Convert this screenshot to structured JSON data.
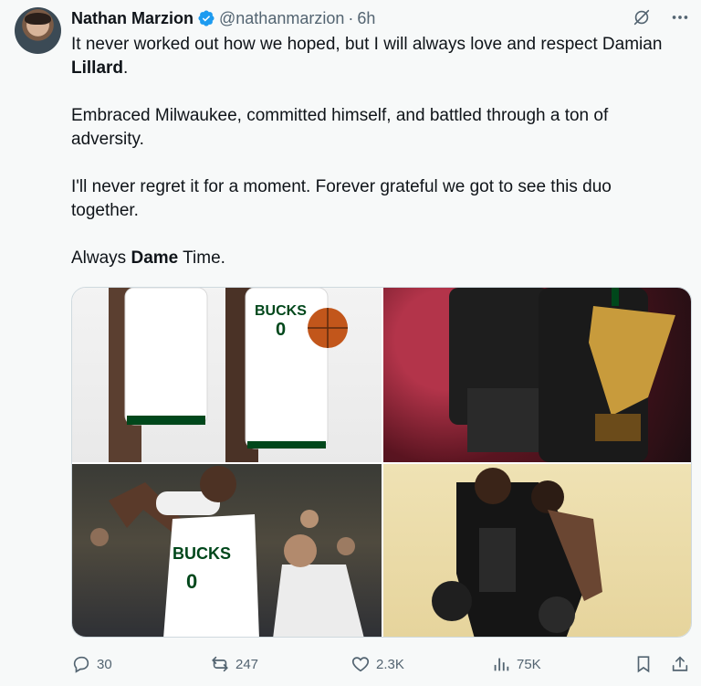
{
  "author": {
    "name": "Nathan Marzion",
    "handle": "@nathanmarzion",
    "separator": "·",
    "time": "6h",
    "verified": true
  },
  "tweet": {
    "p1_before": "It never worked out how we hoped, but I will always love and respect Damian ",
    "p1_bold": "Lillard",
    "p1_after": ".",
    "p2": "Embraced Milwaukee, committed himself, and battled through a ton of adversity.",
    "p3": "I'll never regret it for a moment. Forever grateful we got to see this duo together.",
    "p4_before": "Always ",
    "p4_bold": "Dame",
    "p4_after": " Time."
  },
  "media": {
    "images": [
      {
        "icon": "photo-bucks-duo-portrait"
      },
      {
        "icon": "photo-cup-trophy-celebration"
      },
      {
        "icon": "photo-lillard-pointing"
      },
      {
        "icon": "photo-embrace-on-court"
      }
    ]
  },
  "actions": {
    "reply_count": "30",
    "retweet_count": "247",
    "like_count": "2.3K",
    "view_count": "75K"
  },
  "colors": {
    "verified": "#1d9bf0",
    "muted": "#536471",
    "text": "#0f1419",
    "background": "#f7f9f9",
    "bucks_green": "#00471b"
  }
}
